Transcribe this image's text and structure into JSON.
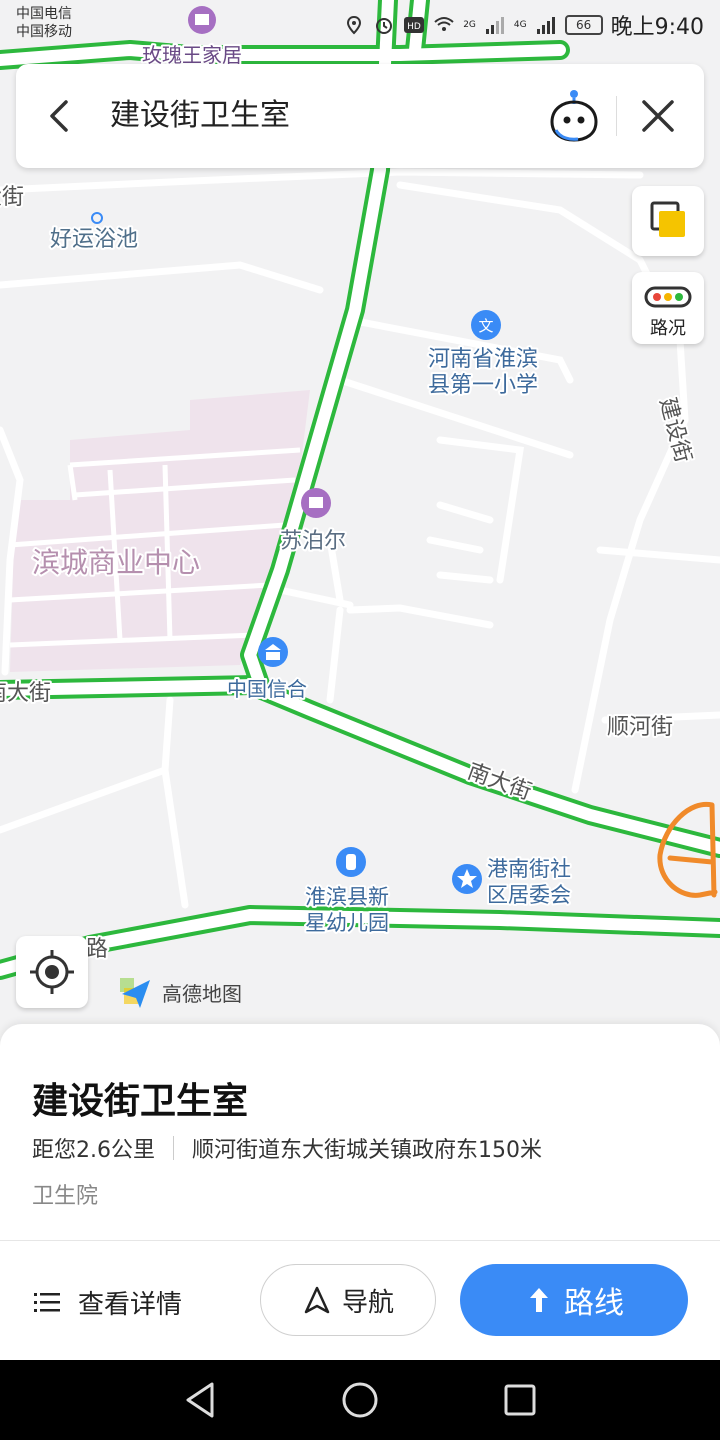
{
  "status_bar": {
    "carrier_1": "中国电信",
    "carrier_2": "中国移动",
    "network_1": "2G",
    "network_2": "4G",
    "battery": "66",
    "time": "晚上9:40"
  },
  "search": {
    "query": "建设街卫生室"
  },
  "map": {
    "labels": {
      "poi_rose_home": "玫瑰王家居",
      "street_left_top": "大街",
      "poi_bathhouse": "好运浴池",
      "poi_school_line1": "河南省淮滨",
      "poi_school_line2": "县第一小学",
      "street_jianshe": "建设街",
      "poi_supor": "苏泊尔",
      "area_bincheng": "滨城商业中心",
      "poi_creditease": "中国信合",
      "street_nan_left": "南大街",
      "street_shunhe": "顺河街",
      "street_nan_mid": "南大街",
      "poi_kinder_line1": "淮滨县新",
      "poi_kinder_line2": "星幼儿园",
      "poi_committee_line1": "港南街社",
      "poi_committee_line2": "区居委会",
      "street_road_left": "路"
    },
    "school_glyph": "文",
    "traffic_label": "路况",
    "brand": "高德地图",
    "colors": {
      "road_congestion_free": "#2db83d",
      "road_fill": "#ffffff",
      "commercial_area": "#efe3ec",
      "poi_icon": "#3a8bf6",
      "shop_icon": "#a66fc2"
    }
  },
  "place": {
    "name": "建设街卫生室",
    "distance": "距您2.6公里",
    "address": "顺河街道东大街城关镇政府东150米",
    "category": "卫生院"
  },
  "actions": {
    "details": "查看详情",
    "navigate": "导航",
    "route": "路线",
    "route_color": "#3a8bf6"
  }
}
